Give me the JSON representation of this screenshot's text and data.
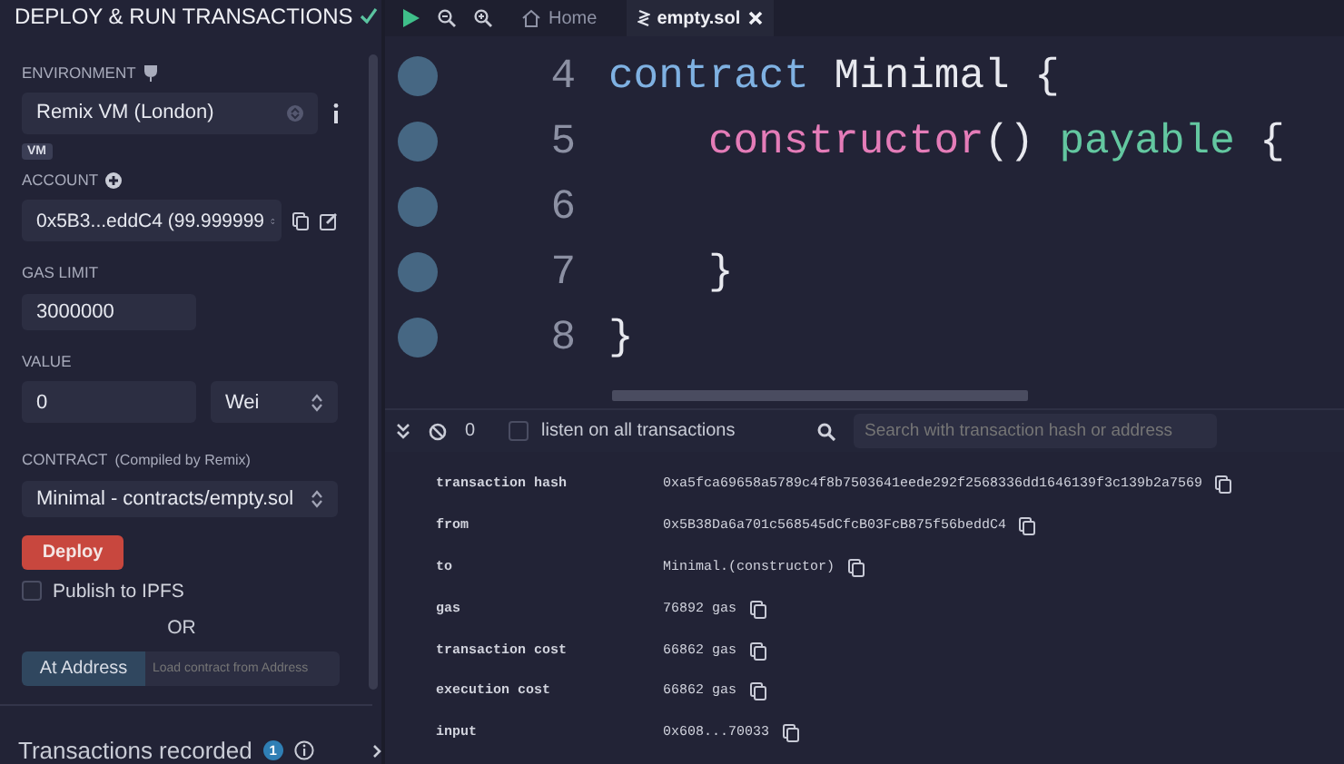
{
  "panel": {
    "title": "DEPLOY & RUN TRANSACTIONS",
    "environment": {
      "label": "ENVIRONMENT",
      "value": "Remix VM (London)",
      "badge": "VM"
    },
    "account": {
      "label": "ACCOUNT",
      "value": "0x5B3...eddC4 (99.999999"
    },
    "gas_limit": {
      "label": "GAS LIMIT",
      "value": "3000000"
    },
    "value": {
      "label": "VALUE",
      "amount": "0",
      "unit": "Wei"
    },
    "contract": {
      "label": "CONTRACT",
      "note": "(Compiled by Remix)",
      "value": "Minimal - contracts/empty.sol"
    },
    "deploy_button": "Deploy",
    "publish": {
      "label": "Publish to IPFS",
      "checked": false
    },
    "or": "OR",
    "at_address": {
      "button": "At Address",
      "placeholder": "Load contract from Address"
    },
    "transactions_recorded": {
      "label": "Transactions recorded",
      "count": "1"
    }
  },
  "tabs": [
    {
      "label": "Home",
      "kind": "home",
      "selected": false
    },
    {
      "label": "empty.sol",
      "kind": "file",
      "selected": true
    }
  ],
  "editor": {
    "lines": [
      {
        "number": "4",
        "indented": false,
        "tokens": [
          {
            "text": "contract",
            "kind": "keyword"
          },
          {
            "text": " Minimal {",
            "kind": "plain"
          }
        ]
      },
      {
        "number": "5",
        "indented": true,
        "tokens": [
          {
            "text": "constructor",
            "kind": "function"
          },
          {
            "text": "() ",
            "kind": "plain"
          },
          {
            "text": "payable",
            "kind": "modifier"
          },
          {
            "text": " {",
            "kind": "plain"
          }
        ]
      },
      {
        "number": "6"
      },
      {
        "number": "7",
        "indented": true,
        "tokens": [
          {
            "text": "}",
            "kind": "plain"
          }
        ]
      },
      {
        "number": "8",
        "indented": false,
        "tokens": [
          {
            "text": "}",
            "kind": "plain"
          }
        ]
      }
    ]
  },
  "terminal": {
    "pending_count": "0",
    "listen": {
      "label": "listen on all transactions",
      "checked": false
    },
    "search": {
      "placeholder": "Search with transaction hash or address"
    },
    "details": [
      {
        "key": "transaction hash",
        "value": "0xa5fca69658a5789c4f8b7503641eede292f2568336dd1646139f3c139b2a7569"
      },
      {
        "key": "from",
        "value": "0x5B38Da6a701c568545dCfcB03FcB875f56beddC4"
      },
      {
        "key": "to",
        "value": "Minimal.(constructor)"
      },
      {
        "key": "gas",
        "value": "76892 gas"
      },
      {
        "key": "transaction cost",
        "value": "66862 gas"
      },
      {
        "key": "execution cost",
        "value": "66862 gas"
      },
      {
        "key": "input",
        "value": "0x608...70033"
      }
    ]
  }
}
